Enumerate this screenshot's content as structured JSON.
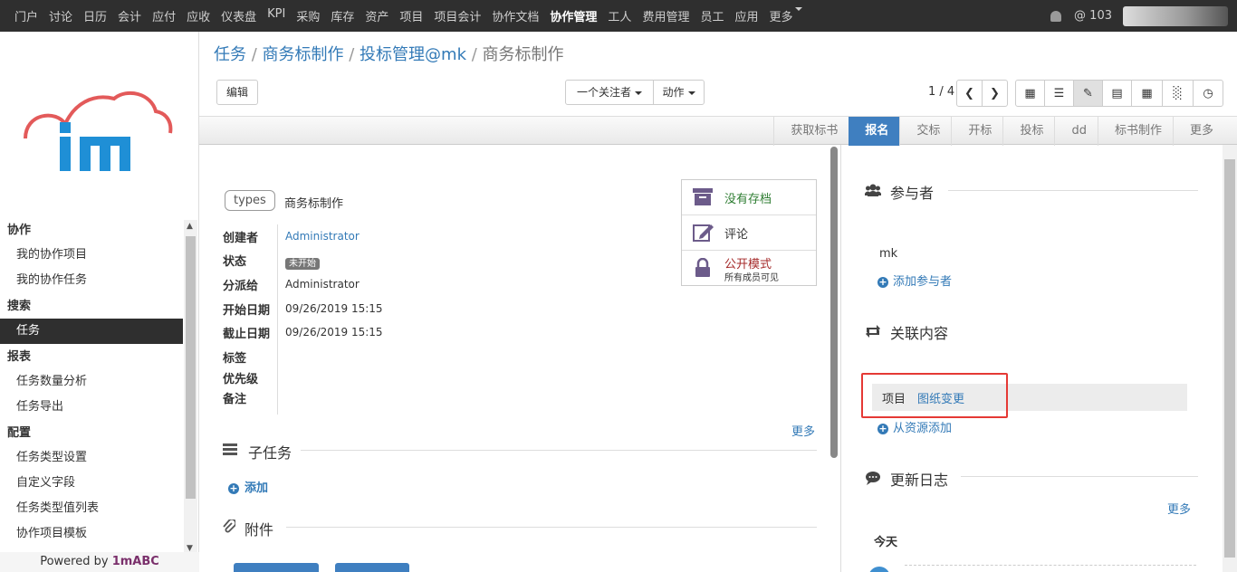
{
  "topnav": {
    "items": [
      "门户",
      "讨论",
      "日历",
      "会计",
      "应付",
      "应收",
      "仪表盘",
      "KPI",
      "采购",
      "库存",
      "资产",
      "项目",
      "项目会计",
      "协作文档",
      "协作管理",
      "工人",
      "费用管理",
      "员工",
      "应用",
      "更多"
    ],
    "active": "协作管理",
    "mentions": "@ 103"
  },
  "sidebar": {
    "groups": [
      {
        "label": "协作",
        "items": [
          "我的协作项目",
          "我的协作任务"
        ]
      },
      {
        "label": "搜索",
        "items": [
          "任务"
        ]
      },
      {
        "label": "报表",
        "items": [
          "任务数量分析",
          "任务导出"
        ]
      },
      {
        "label": "配置",
        "items": [
          "任务类型设置",
          "自定义字段",
          "任务类型值列表",
          "协作项目模板"
        ]
      }
    ],
    "active_item": "任务",
    "powered_prefix": "Powered by ",
    "powered_brand": "1mABC"
  },
  "breadcrumb": {
    "items": [
      "任务",
      "商务标制作",
      "投标管理@mk"
    ],
    "current": "商务标制作"
  },
  "toolbar": {
    "edit": "编辑",
    "followers": "一个关注者",
    "actions": "动作",
    "pager": "1 / 4"
  },
  "stages": {
    "items": [
      "获取标书",
      "报名",
      "交标",
      "开标",
      "投标",
      "dd",
      "标书制作",
      "更多"
    ],
    "active": "报名"
  },
  "record": {
    "types_tag": "types",
    "title": "商务标制作",
    "fields": [
      {
        "label": "创建者",
        "value": "Administrator"
      },
      {
        "label": "状态",
        "value": "未开始"
      },
      {
        "label": "分派给",
        "value": "Administrator"
      },
      {
        "label": "开始日期",
        "value": "09/26/2019 15:15"
      },
      {
        "label": "截止日期",
        "value": "09/26/2019 15:15"
      },
      {
        "label": "标签",
        "value": ""
      },
      {
        "label": "优先级",
        "value": ""
      },
      {
        "label": "备注",
        "value": ""
      }
    ],
    "stat_buttons": [
      {
        "label": "没有存档",
        "sub": ""
      },
      {
        "label": "评论",
        "sub": ""
      },
      {
        "label": "公开模式",
        "sub": "所有成员可见"
      }
    ],
    "more": "更多",
    "subtasks_title": "子任务",
    "add": "添加",
    "attachments_title": "附件"
  },
  "right": {
    "participants_title": "参与者",
    "participants": [
      "mk"
    ],
    "add_participant": "添加参与者",
    "related_title": "关联内容",
    "related": [
      {
        "type": "项目",
        "name": "图纸变更"
      }
    ],
    "add_from_resource": "从资源添加",
    "log_title": "更新日志",
    "log_more": "更多",
    "today": "今天"
  },
  "colors": {
    "topbar": "#2f2f2f",
    "link": "#337ab7",
    "active_stage": "#3f7fc0",
    "highlight_box": "#e53935"
  }
}
